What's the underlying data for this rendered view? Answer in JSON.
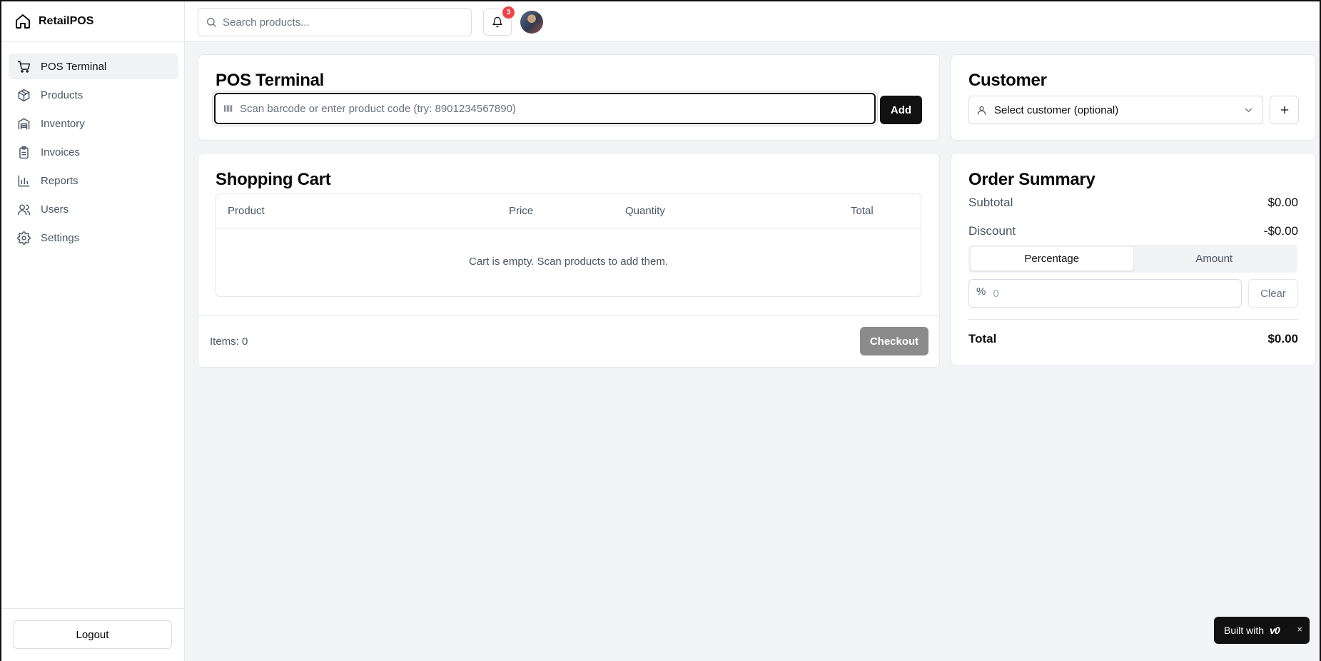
{
  "app": {
    "name": "RetailPOS"
  },
  "sidebar": {
    "items": [
      {
        "label": "POS Terminal",
        "icon": "cart-icon",
        "active": true
      },
      {
        "label": "Products",
        "icon": "package-icon"
      },
      {
        "label": "Inventory",
        "icon": "warehouse-icon"
      },
      {
        "label": "Invoices",
        "icon": "clipboard-icon"
      },
      {
        "label": "Reports",
        "icon": "bar-chart-icon"
      },
      {
        "label": "Users",
        "icon": "users-icon"
      },
      {
        "label": "Settings",
        "icon": "gear-icon"
      }
    ],
    "logout_label": "Logout"
  },
  "header": {
    "search_placeholder": "Search products...",
    "notification_count": "3"
  },
  "pos": {
    "title": "POS Terminal",
    "scan_placeholder": "Scan barcode or enter product code (try: 8901234567890)",
    "add_label": "Add"
  },
  "customer": {
    "title": "Customer",
    "select_label": "Select customer (optional)"
  },
  "cart": {
    "title": "Shopping Cart",
    "columns": [
      "Product",
      "Price",
      "Quantity",
      "Total"
    ],
    "empty_message": "Cart is empty. Scan products to add them.",
    "items_label": "Items: 0",
    "checkout_label": "Checkout"
  },
  "summary": {
    "title": "Order Summary",
    "subtotal_label": "Subtotal",
    "subtotal_value": "$0.00",
    "discount_label": "Discount",
    "discount_value": "-$0.00",
    "tabs": [
      "Percentage",
      "Amount"
    ],
    "discount_symbol": "%",
    "discount_placeholder": "0",
    "clear_label": "Clear",
    "total_label": "Total",
    "total_value": "$0.00"
  },
  "badge": {
    "text": "Built with",
    "logo": "v0",
    "close": "×"
  },
  "colors": {
    "primary": "#111111",
    "notification": "#ef4444",
    "checkout_disabled": "#8b8b8b"
  }
}
